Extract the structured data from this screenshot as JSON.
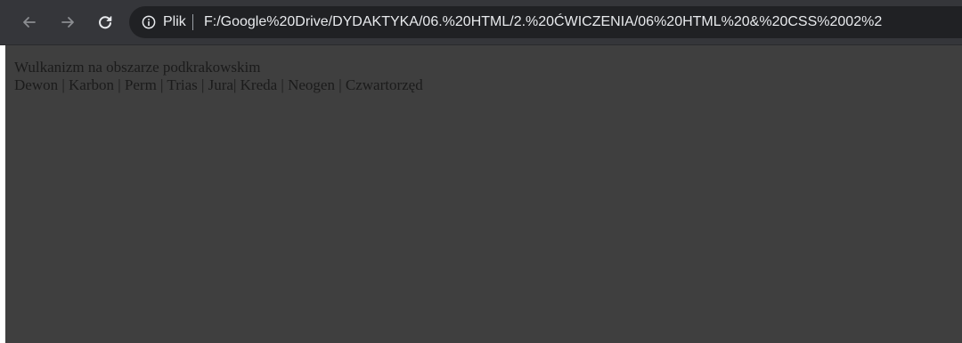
{
  "browser": {
    "back_icon": "arrow-left-icon",
    "forward_icon": "arrow-right-icon",
    "reload_icon": "reload-icon",
    "info_icon": "info-circle-icon",
    "address_scheme": "Plik",
    "address_url": "F:/Google%20Drive/DYDAKTYKA/06.%20HTML/2.%20ĆWICZENIA/06%20HTML%20&%20CSS%2002%2",
    "toolbar_color": "#35363a",
    "omnibox_color": "#202124"
  },
  "page": {
    "background_color": "#3f3f3f",
    "title": "Wulkanizm na obszarze podkrakowskim",
    "nav": [
      {
        "label": "Dewon",
        "sep": " | "
      },
      {
        "label": "Karbon",
        "sep": " | "
      },
      {
        "label": "Perm",
        "sep": " | "
      },
      {
        "label": "Trias",
        "sep": " | "
      },
      {
        "label": "Jura",
        "sep": "| "
      },
      {
        "label": "Kreda",
        "sep": " | "
      },
      {
        "label": "Neogen",
        "sep": " | "
      },
      {
        "label": "Czwartorzęd",
        "sep": ""
      }
    ]
  }
}
